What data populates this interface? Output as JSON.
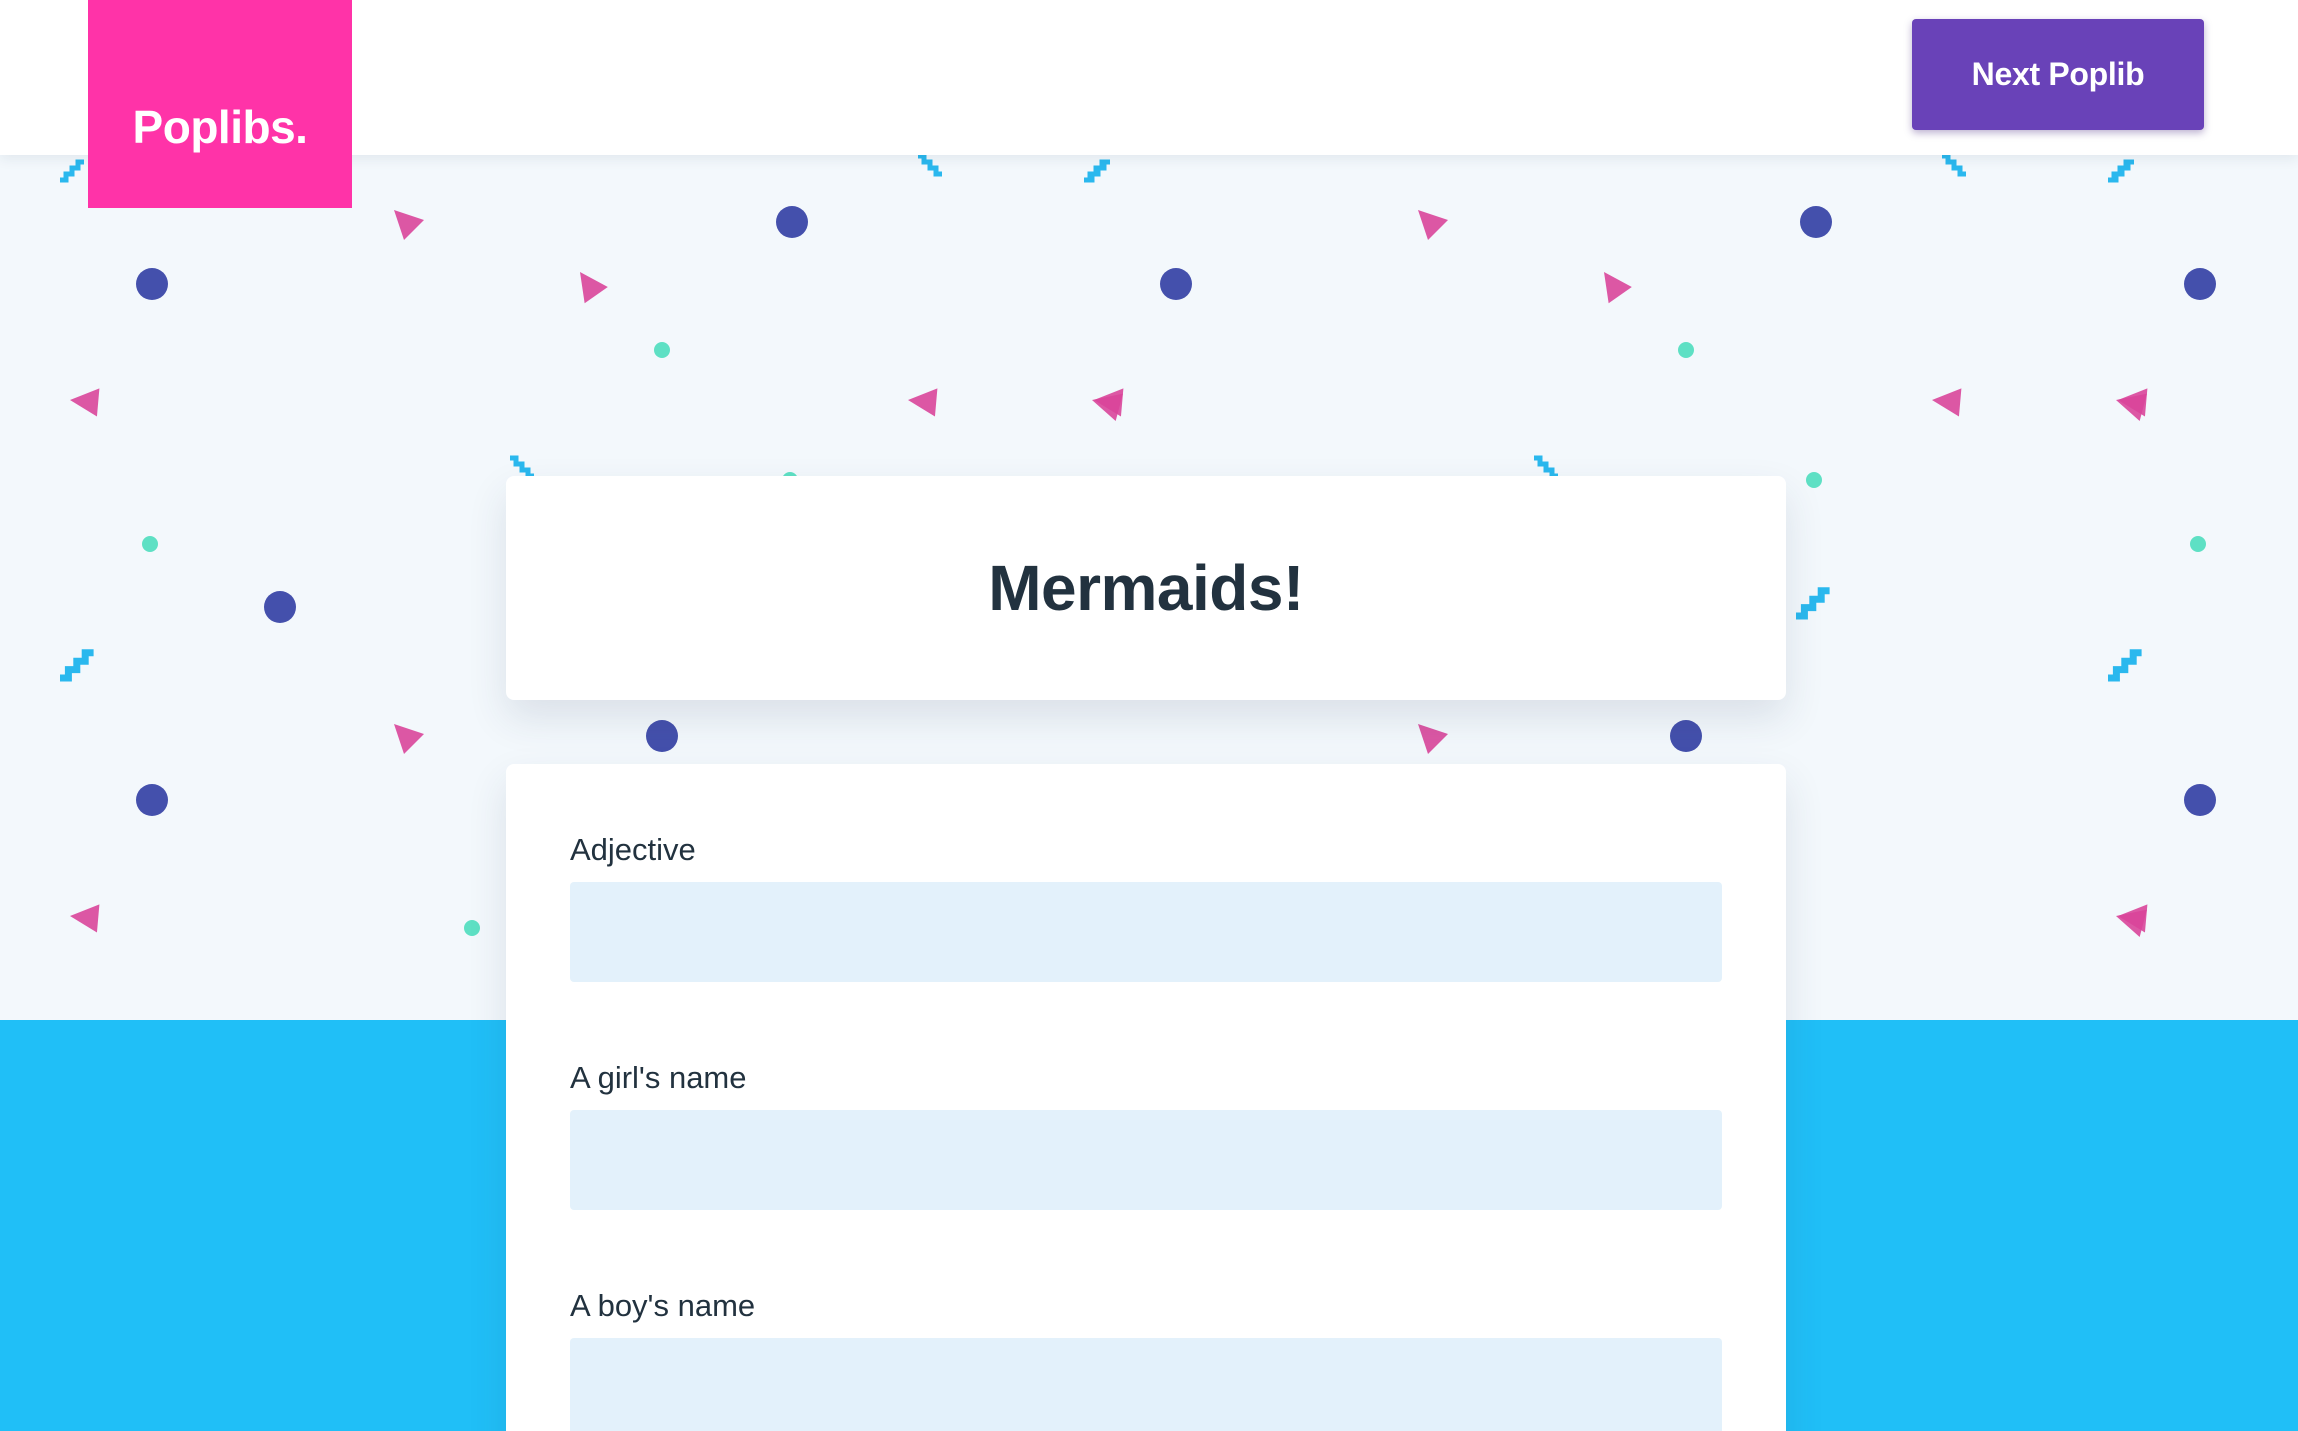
{
  "header": {
    "logo_text": "Poplibs.",
    "next_button_label": "Next Poplib"
  },
  "poplib": {
    "title": "Mermaids!",
    "fields": [
      {
        "label": "Adjective",
        "value": "",
        "placeholder": ""
      },
      {
        "label": "A girl's name",
        "value": "",
        "placeholder": ""
      },
      {
        "label": "A boy's name",
        "value": "",
        "placeholder": ""
      }
    ]
  },
  "colors": {
    "logo_bg": "#ff33a8",
    "button_bg": "#6942b8",
    "accent_blue": "#20bff7",
    "page_bg": "#f3f8fc",
    "input_bg": "#e3f1fb",
    "confetti_circle": "#4450ac",
    "confetti_triangle": "#d9459a",
    "confetti_dot": "#5ee0c4",
    "confetti_zigzag": "#2ab8ee"
  }
}
